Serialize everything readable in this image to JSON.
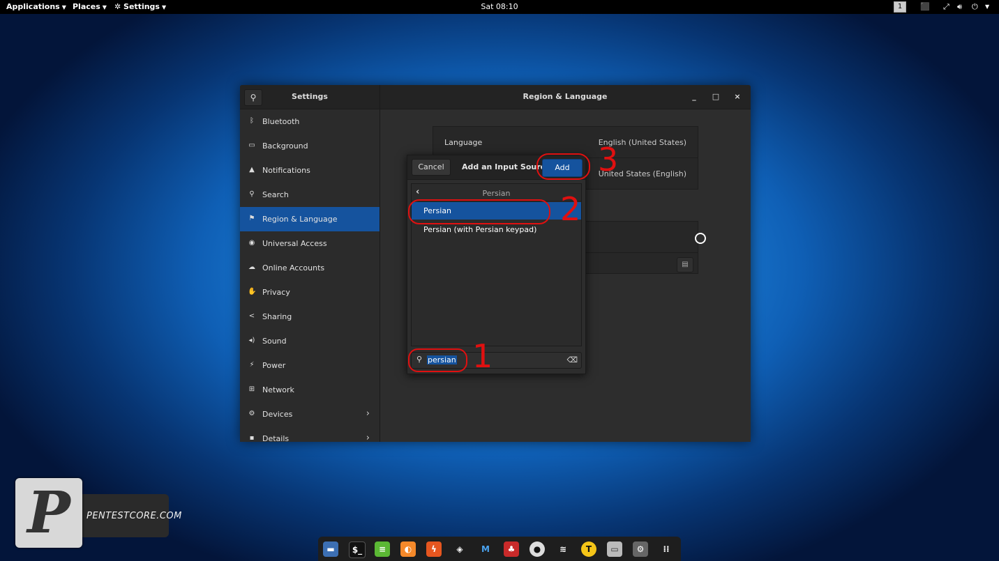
{
  "topbar": {
    "applications": "Applications",
    "places": "Places",
    "settings": "Settings",
    "clock": "Sat 08:10",
    "workspace": "1"
  },
  "window": {
    "sidebar_title": "Settings",
    "main_title": "Region & Language",
    "minimize": "_",
    "maximize": "□",
    "close": "×"
  },
  "sidebar": {
    "items": [
      {
        "label": "Bluetooth",
        "icon": "bluetooth-icon"
      },
      {
        "label": "Background",
        "icon": "background-icon"
      },
      {
        "label": "Notifications",
        "icon": "bell-icon"
      },
      {
        "label": "Search",
        "icon": "search-icon"
      },
      {
        "label": "Region & Language",
        "icon": "flag-icon"
      },
      {
        "label": "Universal Access",
        "icon": "accessibility-icon"
      },
      {
        "label": "Online Accounts",
        "icon": "cloud-icon"
      },
      {
        "label": "Privacy",
        "icon": "hand-icon"
      },
      {
        "label": "Sharing",
        "icon": "share-icon"
      },
      {
        "label": "Sound",
        "icon": "speaker-icon"
      },
      {
        "label": "Power",
        "icon": "power-icon"
      },
      {
        "label": "Network",
        "icon": "network-icon"
      },
      {
        "label": "Devices",
        "icon": "devices-icon"
      },
      {
        "label": "Details",
        "icon": "details-icon"
      }
    ]
  },
  "region": {
    "language_label": "Language",
    "language_value": "English (United States)",
    "formats_value": "United States (English)"
  },
  "dialog": {
    "cancel": "Cancel",
    "title": "Add an Input Source",
    "add": "Add",
    "list_header": "Persian",
    "rows": [
      "Persian",
      "Persian (with Persian keypad)"
    ],
    "search_value": "persian"
  },
  "annotations": [
    "1",
    "2",
    "3"
  ],
  "logo": {
    "text": "PENTESTCORE.COM",
    "letter": "P"
  },
  "colors": {
    "accent": "#15539e",
    "annotation": "#e01010"
  }
}
